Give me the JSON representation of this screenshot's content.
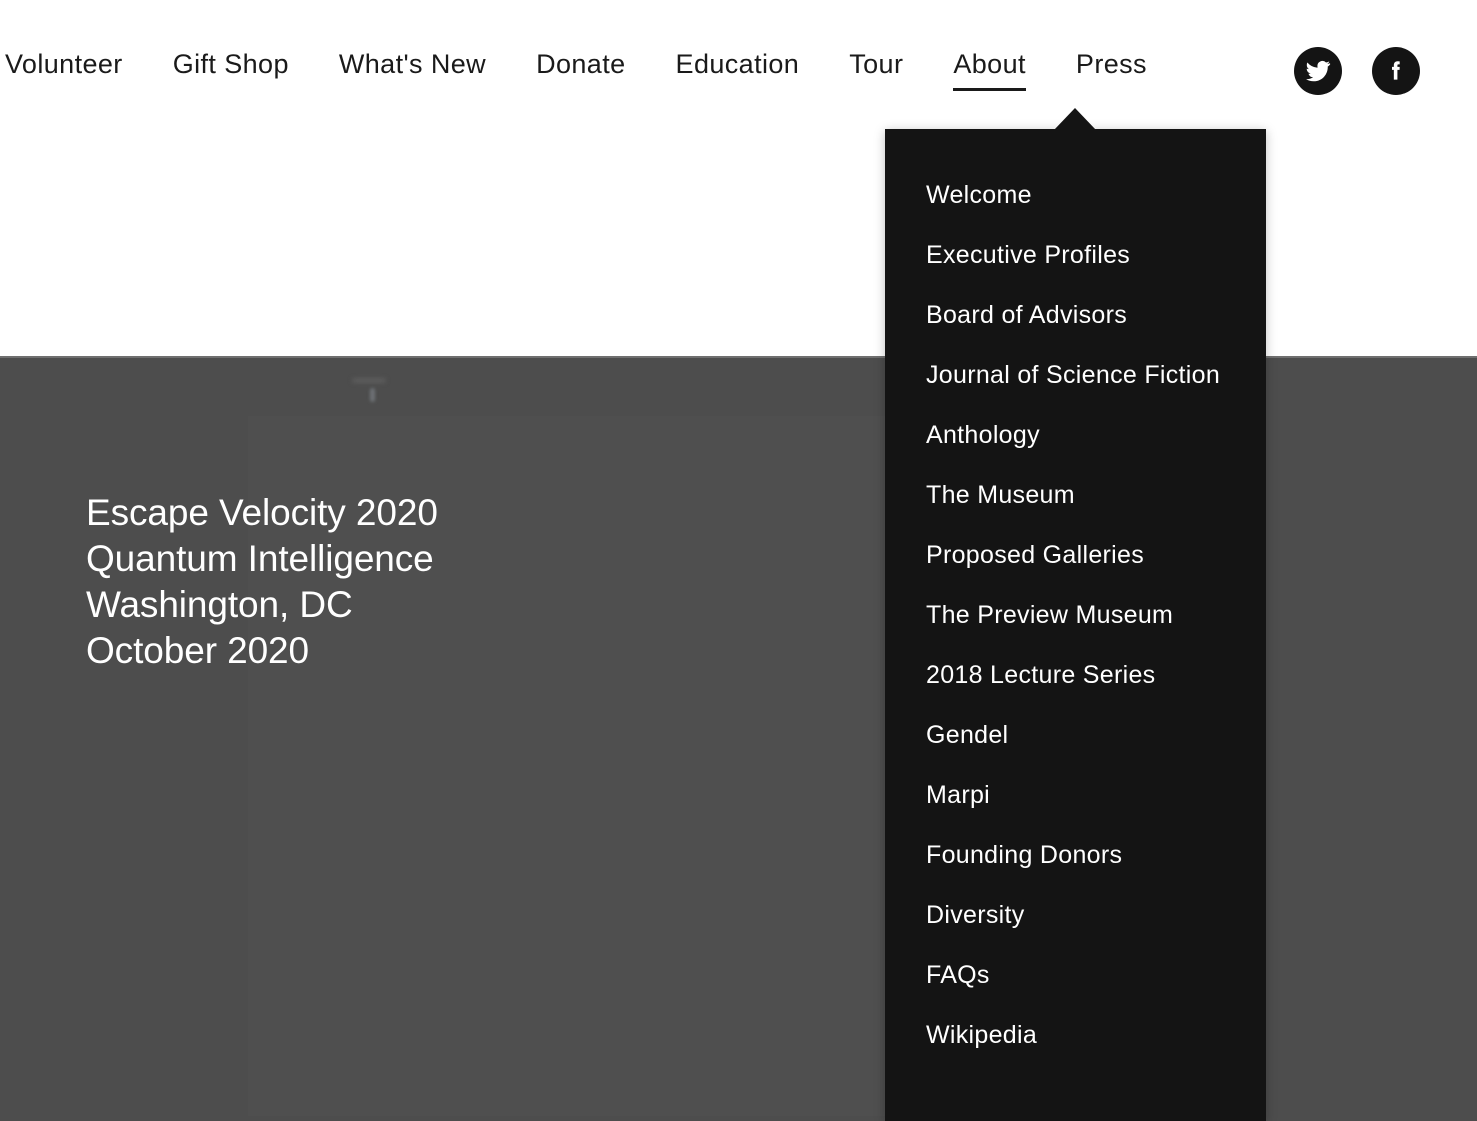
{
  "site": {
    "nav": {
      "items": [
        {
          "label": "Volunteer",
          "active": false
        },
        {
          "label": "Gift Shop",
          "active": false
        },
        {
          "label": "What's New",
          "active": false
        },
        {
          "label": "Donate",
          "active": false
        },
        {
          "label": "Education",
          "active": false
        },
        {
          "label": "Tour",
          "active": false
        },
        {
          "label": "About",
          "active": true
        },
        {
          "label": "Press",
          "active": false
        }
      ],
      "social": [
        {
          "name": "twitter-icon",
          "label": "Twitter"
        },
        {
          "name": "facebook-icon",
          "label": "Facebook"
        }
      ]
    },
    "dropdown": {
      "parent": "About",
      "items": [
        {
          "label": "Welcome"
        },
        {
          "label": "Executive Profiles"
        },
        {
          "label": "Board of Advisors"
        },
        {
          "label": "Journal of Science Fiction"
        },
        {
          "label": "Anthology"
        },
        {
          "label": "The Museum"
        },
        {
          "label": "Proposed Galleries"
        },
        {
          "label": "The Preview Museum"
        },
        {
          "label": "2018 Lecture Series"
        },
        {
          "label": "Gendel"
        },
        {
          "label": "Marpi"
        },
        {
          "label": "Founding Donors"
        },
        {
          "label": "Diversity"
        },
        {
          "label": "FAQs"
        },
        {
          "label": "Wikipedia"
        }
      ]
    },
    "hero": {
      "headline": "Escape Velocity 2020\nQuantum Intelligence\nWashington, DC\nOctober 2020",
      "lines": [
        "Escape Velocity 2020",
        "Quantum Intelligence",
        "Washington, DC",
        "October 2020"
      ]
    },
    "colors": {
      "menu_background": "#141414",
      "hero_background": "#4d4d4d",
      "nav_text": "#1a1a1a",
      "menu_text": "#ffffff",
      "page_background": "#ffffff"
    }
  }
}
